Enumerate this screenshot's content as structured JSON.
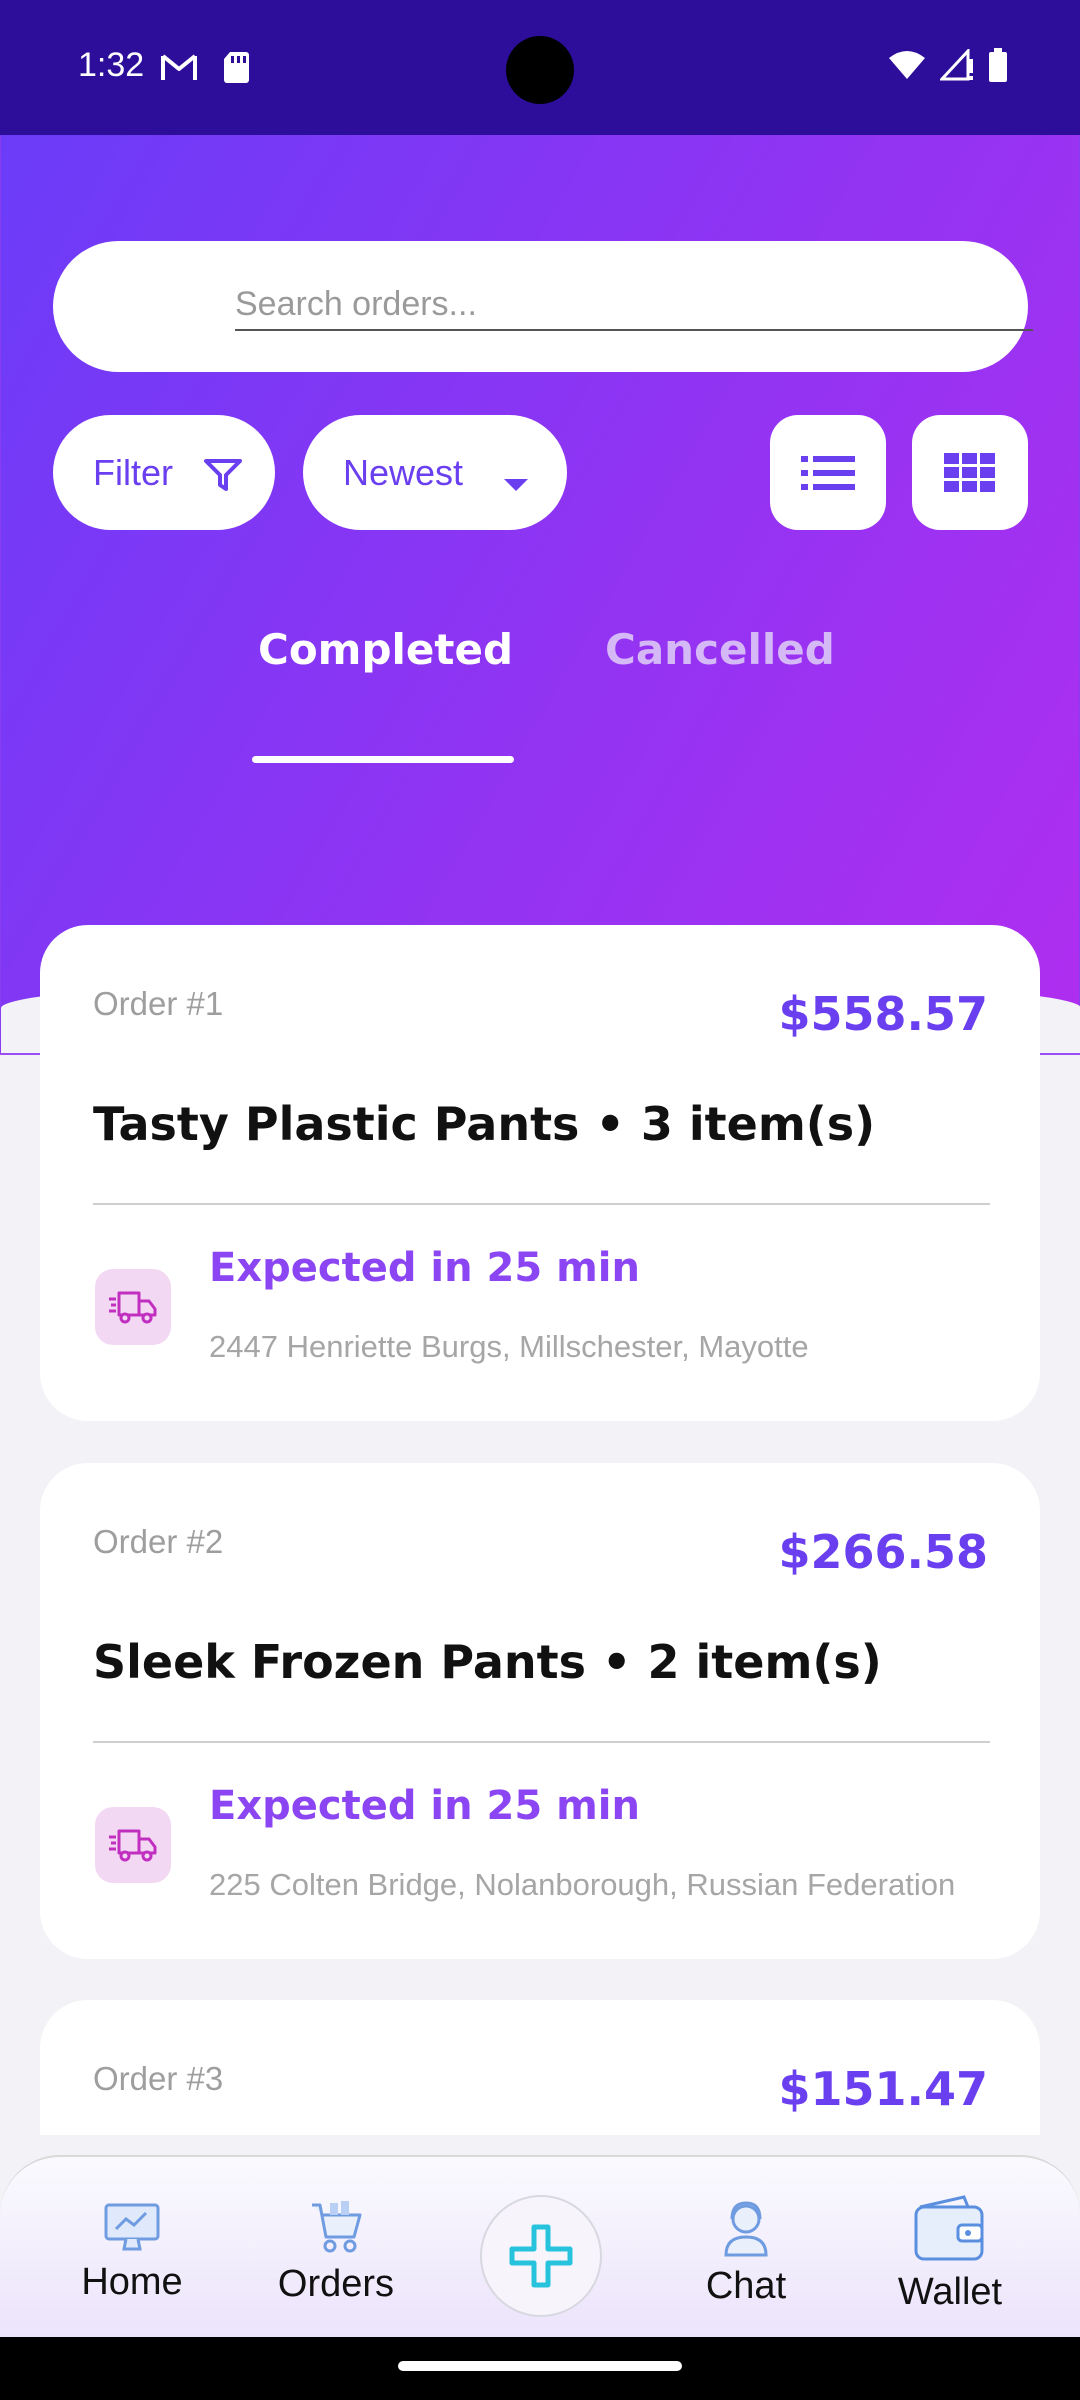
{
  "status_bar": {
    "time": "1:32"
  },
  "search": {
    "placeholder": "Search orders..."
  },
  "controls": {
    "filter_label": "Filter",
    "sort_label": "Newest"
  },
  "tabs": [
    {
      "label": "Completed",
      "active": true
    },
    {
      "label": "Cancelled",
      "active": false
    }
  ],
  "orders": [
    {
      "number": "Order #1",
      "price": "$558.57",
      "title": "Tasty Plastic Pants • 3 item(s)",
      "eta": "Expected in 25 min",
      "address": "2447 Henriette Burgs, Millschester, Mayotte"
    },
    {
      "number": "Order #2",
      "price": "$266.58",
      "title": "Sleek Frozen Pants • 2 item(s)",
      "eta": "Expected in 25 min",
      "address": "225 Colten Bridge, Nolanborough, Russian Federation"
    },
    {
      "number": "Order #3",
      "price": "$151.47",
      "title": "",
      "eta": "",
      "address": ""
    }
  ],
  "bottom_nav": {
    "home": "Home",
    "orders": "Orders",
    "chat": "Chat",
    "wallet": "Wallet"
  },
  "colors": {
    "status_bar": "#2c0e9a",
    "accent": "#6a3ff0",
    "eta": "#8b45f2",
    "gradient_start": "#6b3cf8",
    "gradient_end": "#b02ef0"
  },
  "icons": {
    "status": [
      "gmail-icon",
      "sd-card-icon",
      "wifi-icon",
      "signal-icon",
      "battery-icon"
    ],
    "filter": "filter-funnel-icon",
    "sort": "caret-down-icon",
    "list_view": "list-view-icon",
    "grid_view": "grid-view-icon",
    "delivery": "delivery-truck-icon",
    "fab": "plus-icon"
  }
}
